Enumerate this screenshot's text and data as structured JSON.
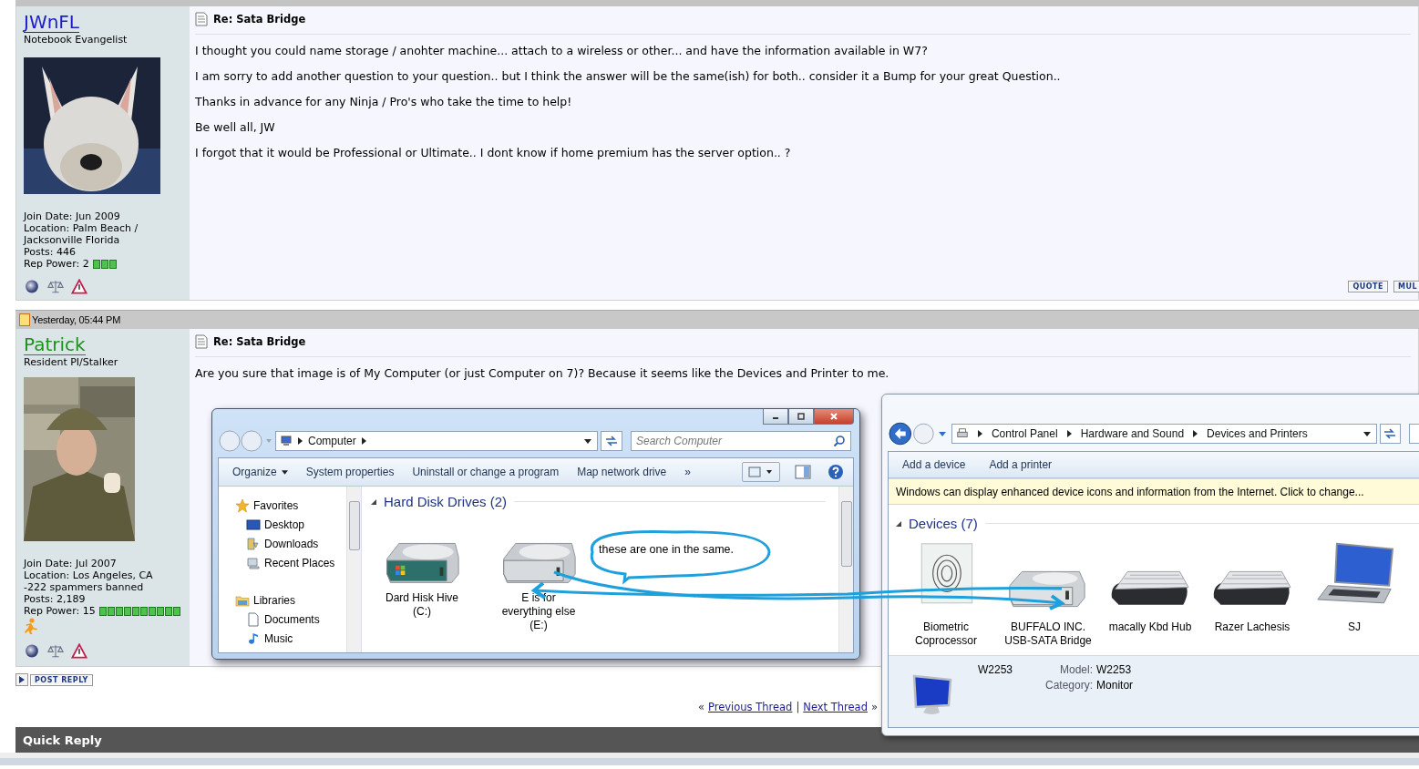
{
  "posts": [
    {
      "author": {
        "name": "JWnFL",
        "color": "#1c1ccc",
        "title": "Notebook Evangelist",
        "details": [
          "Join Date: Jun 2009",
          "Location: Palm Beach / Jacksonville Florida",
          "Posts: 446"
        ],
        "rep_label": "Rep Power: 2",
        "stars": 3,
        "im_icon": false
      },
      "subject": "Re: Sata Bridge",
      "paragraphs": [
        "I thought you could name storage / anohter machine... attach to a wireless or other... and have the information available in W7?",
        "I am sorry to add another question to your question.. but I think the answer will be the same(ish) for both.. consider it a Bump for your great Question..",
        "Thanks in advance for any Ninja / Pro's who take the time to help!",
        "Be well all, JW",
        "I forgot that it would be Professional or Ultimate.. I dont know if home premium has the server option.. ?"
      ],
      "buttons": [
        "QUOTE",
        "MUL"
      ]
    },
    {
      "date": "Yesterday, 05:44 PM",
      "author": {
        "name": "Patrick",
        "color": "#1f8f1f",
        "title": "Resident PI/Stalker",
        "details": [
          "Join Date: Jul 2007",
          "Location: Los Angeles, CA",
          "-222 spammers banned",
          "Posts: 2,189"
        ],
        "rep_label": "Rep Power: 15",
        "stars": 10,
        "im_icon": true
      },
      "subject": "Re: Sata Bridge",
      "paragraphs": [
        "Are you sure that image is of My Computer (or just Computer on 7)? Because it seems like the Devices and Printer to me."
      ],
      "embedded": {
        "explorer": {
          "address": [
            "Computer"
          ],
          "search_placeholder": "Search Computer",
          "toolbar": [
            {
              "label": "Organize",
              "menu": true
            },
            {
              "label": "System properties",
              "menu": false
            },
            {
              "label": "Uninstall or change a program",
              "menu": false
            },
            {
              "label": "Map network drive",
              "menu": false
            }
          ],
          "more": "»",
          "nav_groups": [
            {
              "label": "Favorites",
              "items": [
                "Desktop",
                "Downloads",
                "Recent Places"
              ]
            },
            {
              "label": "Libraries",
              "items": [
                "Documents",
                "Music"
              ]
            }
          ],
          "group_title": "Hard Disk Drives (2)",
          "drives": [
            {
              "lines": [
                "Dard Hisk Hive",
                "(C:)"
              ],
              "windows_logo": true
            },
            {
              "lines": [
                "E is for",
                "everything else",
                "(E:)"
              ],
              "windows_logo": false
            }
          ]
        },
        "devices": {
          "breadcrumb": [
            "Control Panel",
            "Hardware and Sound",
            "Devices and Printers"
          ],
          "toolbar": [
            "Add a device",
            "Add a printer"
          ],
          "info_bar": "Windows can display enhanced device icons and information from the Internet. Click to change...",
          "group_title": "Devices (7)",
          "items": [
            {
              "kind": "fingerprint",
              "lines": [
                "Biometric",
                "Coprocessor"
              ]
            },
            {
              "kind": "drive",
              "lines": [
                "BUFFALO INC.",
                "USB-SATA Bridge"
              ]
            },
            {
              "kind": "keyboard",
              "lines": [
                "macally Kbd Hub"
              ]
            },
            {
              "kind": "keyboard",
              "lines": [
                "Razer Lachesis"
              ]
            },
            {
              "kind": "laptop",
              "lines": [
                "SJ"
              ]
            }
          ],
          "details": {
            "name": "W2253",
            "fields": [
              {
                "label": "Model:",
                "value": "W2253"
              },
              {
                "label": "Category:",
                "value": "Monitor"
              }
            ]
          }
        },
        "annotation": "these are one in the same."
      }
    }
  ],
  "post_reply_button": "POST REPLY",
  "thread_nav": {
    "prev_mark": "«",
    "previous": "Previous Thread",
    "separator": "|",
    "next": "Next Thread",
    "next_mark": "»"
  },
  "quick_reply": "Quick Reply"
}
